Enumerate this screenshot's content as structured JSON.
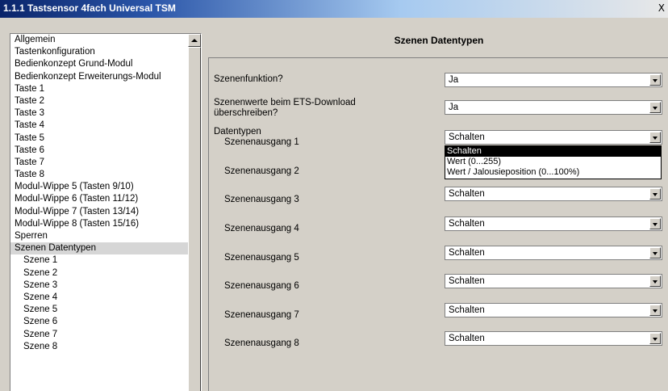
{
  "window": {
    "title": "1.1.1 Tastsensor 4fach Universal TSM",
    "close_glyph": "X"
  },
  "tree": {
    "items": [
      {
        "label": "Allgemein",
        "level": 0
      },
      {
        "label": "Tastenkonfiguration",
        "level": 0
      },
      {
        "label": "Bedienkonzept Grund-Modul",
        "level": 0
      },
      {
        "label": "Bedienkonzept Erweiterungs-Modul",
        "level": 0
      },
      {
        "label": "Taste 1",
        "level": 0
      },
      {
        "label": "Taste 2",
        "level": 0
      },
      {
        "label": "Taste 3",
        "level": 0
      },
      {
        "label": "Taste 4",
        "level": 0
      },
      {
        "label": "Taste 5",
        "level": 0
      },
      {
        "label": "Taste 6",
        "level": 0
      },
      {
        "label": "Taste 7",
        "level": 0
      },
      {
        "label": "Taste 8",
        "level": 0
      },
      {
        "label": "Modul-Wippe 5 (Tasten 9/10)",
        "level": 0
      },
      {
        "label": "Modul-Wippe 6 (Tasten 11/12)",
        "level": 0
      },
      {
        "label": "Modul-Wippe 7 (Tasten 13/14)",
        "level": 0
      },
      {
        "label": "Modul-Wippe 8 (Tasten 15/16)",
        "level": 0
      },
      {
        "label": "Sperren",
        "level": 0
      },
      {
        "label": "Szenen Datentypen",
        "level": 0,
        "selected": true
      },
      {
        "label": "Szene 1",
        "level": 1
      },
      {
        "label": "Szene 2",
        "level": 1
      },
      {
        "label": "Szene 3",
        "level": 1
      },
      {
        "label": "Szene 4",
        "level": 1
      },
      {
        "label": "Szene 5",
        "level": 1
      },
      {
        "label": "Szene 6",
        "level": 1
      },
      {
        "label": "Szene 7",
        "level": 1
      },
      {
        "label": "Szene 8",
        "level": 1
      }
    ]
  },
  "panel": {
    "title": "Szenen Datentypen",
    "szenenfunktion": {
      "label": "Szenenfunktion?",
      "value": "Ja"
    },
    "ueberschreiben": {
      "label_line1": "Szenenwerte beim ETS-Download",
      "label_line2": "überschreiben?",
      "value": "Ja"
    },
    "datentypen_label": "Datentypen",
    "outputs": [
      {
        "label": "Szenenausgang 1",
        "value": "Schalten"
      },
      {
        "label": "Szenenausgang 2",
        "value": ""
      },
      {
        "label": "Szenenausgang 3",
        "value": "Schalten"
      },
      {
        "label": "Szenenausgang 4",
        "value": "Schalten"
      },
      {
        "label": "Szenenausgang 5",
        "value": "Schalten"
      },
      {
        "label": "Szenenausgang 6",
        "value": "Schalten"
      },
      {
        "label": "Szenenausgang 7",
        "value": "Schalten"
      },
      {
        "label": "Szenenausgang 8",
        "value": "Schalten"
      }
    ],
    "dropdown_options": [
      "Schalten",
      "Wert (0...255)",
      "Wert / Jalousieposition (0...100%)"
    ]
  }
}
